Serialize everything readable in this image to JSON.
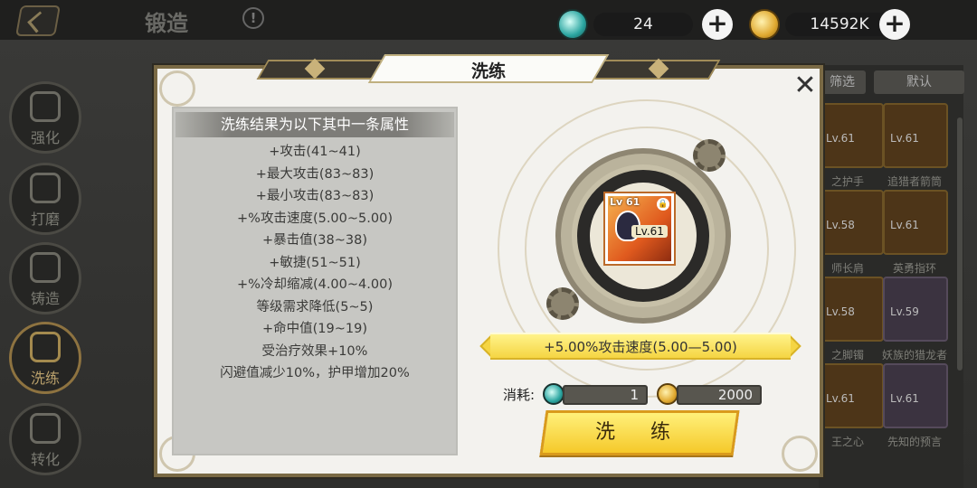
{
  "header": {
    "title": "锻造",
    "info_label": "!"
  },
  "resources": {
    "gems": {
      "value": "24",
      "plus": "+"
    },
    "gold": {
      "value": "14592K",
      "plus": "+"
    }
  },
  "sidebar": {
    "items": [
      {
        "label": "强化"
      },
      {
        "label": "打磨"
      },
      {
        "label": "铸造"
      },
      {
        "label": "洗练"
      },
      {
        "label": "转化"
      }
    ]
  },
  "inventory": {
    "filter_label": "筛选",
    "sort_label": "默认",
    "cells": [
      {
        "lv": "Lv.61",
        "name": "之护手"
      },
      {
        "lv": "Lv.61",
        "name": "追猎者箭筒"
      },
      {
        "lv": "Lv.58",
        "name": "师长肩"
      },
      {
        "lv": "Lv.61",
        "name": "英勇指环"
      },
      {
        "lv": "Lv.58",
        "name": "之脚镯"
      },
      {
        "lv": "Lv.59",
        "name": "妖族的猎龙者"
      },
      {
        "lv": "Lv.61",
        "name": "王之心"
      },
      {
        "lv": "Lv.61",
        "name": "先知的预言"
      }
    ]
  },
  "modal": {
    "title": "洗练",
    "close_label": "✕",
    "panel_title": "洗练结果为以下其中一条属性",
    "attributes": [
      "+攻击(41~41)",
      "+最大攻击(83~83)",
      "+最小攻击(83~83)",
      "+%攻击速度(5.00~5.00)",
      "+暴击值(38~38)",
      "+敏捷(51~51)",
      "+%冷却缩减(4.00~4.00)",
      "等级需求降低(5~5)",
      "+命中值(19~19)",
      "受治疗效果+10%",
      "闪避值减少10%，护甲增加20%"
    ],
    "item": {
      "level_badge": "Lv 61",
      "level_tag": "Lv.61",
      "lock": "🔒"
    },
    "result": "+5.00%攻击速度(5.00—5.00)",
    "cost": {
      "label": "消耗:",
      "gem_cost": "1",
      "gold_cost": "2000"
    },
    "refine_button": "洗 练"
  },
  "colors": {
    "accent": "#f5d543",
    "frame": "#7a6a45",
    "button": "#f5c92a"
  }
}
